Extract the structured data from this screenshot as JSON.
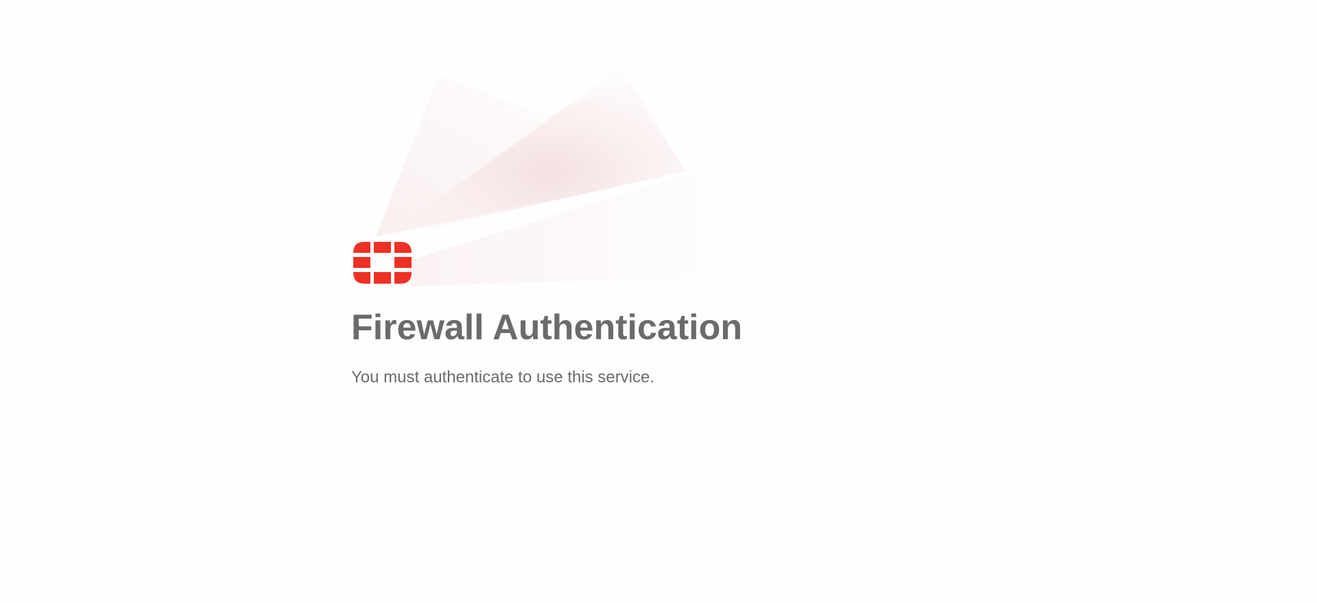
{
  "page": {
    "title": "Firewall Authentication",
    "message": "You must authenticate to use this service."
  },
  "logo": {
    "icon": "fortinet-logo-icon",
    "color": "#ee3124"
  },
  "colors": {
    "text": "#6b6b6b",
    "accent": "#ee3124",
    "background": "#ffffff"
  }
}
